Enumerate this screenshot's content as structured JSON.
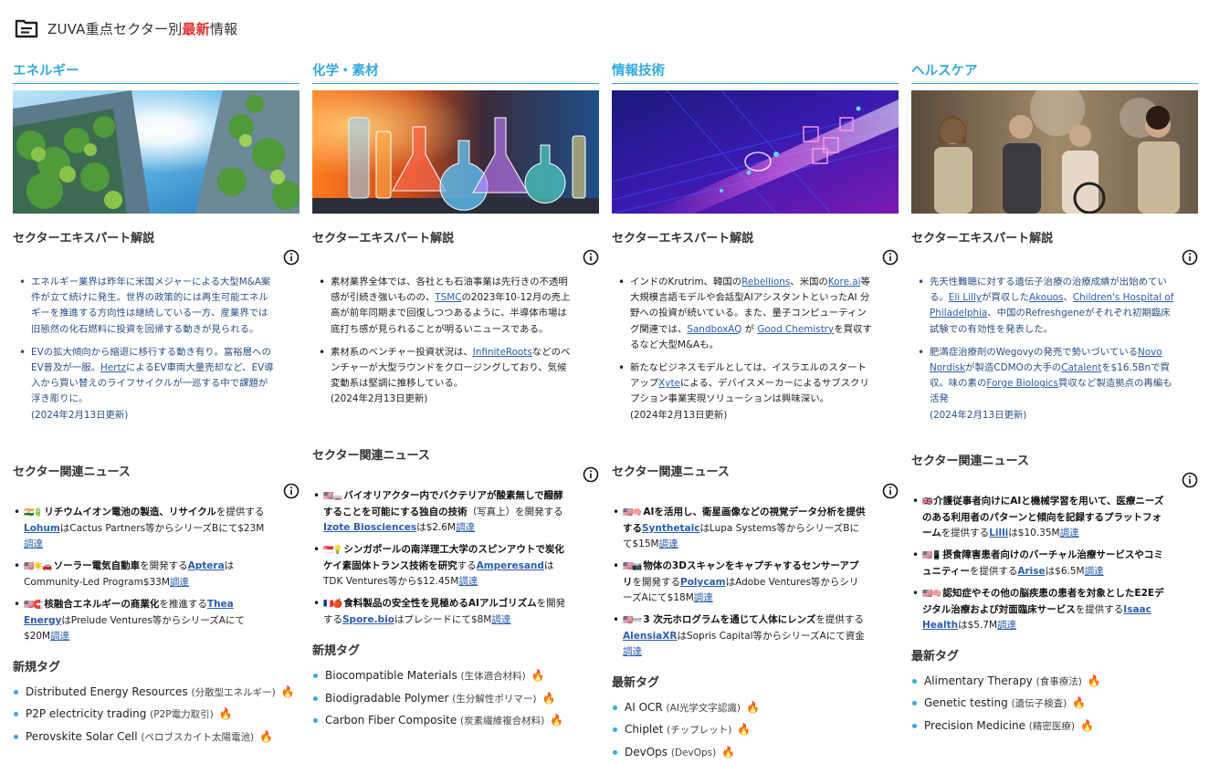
{
  "header": {
    "title_pre": "ZUVA重点セクター別",
    "title_hl": "最新",
    "title_post": "情報"
  },
  "labels": {
    "expert": "セクターエキスパート解説",
    "news": "セクター関連ニュース"
  },
  "columns": [
    {
      "sector": "エネルギー",
      "expert": [
        {
          "segs": [
            {
              "t": "エネルギー業界は昨年に米国メジャーによる大型M&A案件が立て続けに発生。世界の政策的には再生可能エネルギーを推進する方向性は継続している一方、産業界では旧態然の化石燃料に投資を回帰する動きが見られる。"
            }
          ]
        },
        {
          "segs": [
            {
              "t": "EVの拡大傾向から縮退に移行する動き有り。富裕層へのEV普及が一服。"
            },
            {
              "t": "Hertz",
              "link": true
            },
            {
              "t": "によるEV車両大量売却など、EV導入から買い替えのライフサイクルが一巡する中で課題が浮き彫りに。"
            }
          ]
        }
      ],
      "updated": "(2024年2月13日更新)",
      "news": [
        {
          "flags": "🇮🇳🔋",
          "segs": [
            {
              "t": "リチウムイオン電池の製造、リサイクル",
              "b": true
            },
            {
              "t": "を提供する"
            },
            {
              "t": "Lohum",
              "co": true
            },
            {
              "t": "はCactus Partners等からシリーズBにて$23M"
            },
            {
              "t": "調達",
              "link": true
            }
          ]
        },
        {
          "flags": "🇺🇸☀️🚗",
          "segs": [
            {
              "t": "ソーラー電気自動車",
              "b": true
            },
            {
              "t": "を開発する"
            },
            {
              "t": "Aptera",
              "co": true
            },
            {
              "t": "はCommunity-Led Program$33M"
            },
            {
              "t": "調達",
              "link": true
            }
          ]
        },
        {
          "flags": "🇺🇸🧲",
          "segs": [
            {
              "t": "核融合エネルギーの商業化",
              "b": true
            },
            {
              "t": "を推進する"
            },
            {
              "t": "Thea Energy",
              "co": true
            },
            {
              "t": "はPrelude Ventures等からシリーズAにて$20M"
            },
            {
              "t": "調達",
              "link": true
            }
          ]
        }
      ],
      "tag_head": "新規タグ",
      "tags": [
        {
          "en": "Distributed Energy Resources",
          "ja": "(分散型エネルギー)"
        },
        {
          "en": "P2P electricity trading",
          "ja": "(P2P電力取引)"
        },
        {
          "en": "Perovskite Solar Cell",
          "ja": "(ペロブスカイト太陽電池)"
        }
      ]
    },
    {
      "sector": "化学・素材",
      "expert": [
        {
          "segs": [
            {
              "t": "素材業界全体では、各社とも石油事業は先行きの不透明感が引続き強いものの、"
            },
            {
              "t": "TSMC",
              "link": true
            },
            {
              "t": "の2023年10-12月の売上高が前年同期まで回復しつつあるように、半導体市場は底打ち感が見られることが明るいニュースである。"
            }
          ]
        },
        {
          "segs": [
            {
              "t": "素材系のベンチャー投資状況は、"
            },
            {
              "t": "InfiniteRoots",
              "link": true
            },
            {
              "t": "などのベンチャーが大型ラウンドをクロージングしており、気候変動系は堅調に推移している。"
            }
          ]
        }
      ],
      "updated": "(2024年2月13日更新)",
      "news": [
        {
          "flags": "🇺🇸🧫",
          "segs": [
            {
              "t": "バイオリアクター内でバクテリアが酸素無しで醱酵することを可能にする独自の技術",
              "b": true
            },
            {
              "t": "（写真上）を開発する"
            },
            {
              "t": "Izote Biosciences",
              "co": true
            },
            {
              "t": "は$2.6M"
            },
            {
              "t": "調達",
              "link": true
            }
          ]
        },
        {
          "flags": "🇸🇬💡",
          "segs": [
            {
              "t": "シンガポールの南洋理工大学のスピンアウトで炭化ケイ素固体トランス技術を研究",
              "b": true
            },
            {
              "t": "する"
            },
            {
              "t": "Amperesand",
              "co": true
            },
            {
              "t": "はTDK Ventures等から$12.45M"
            },
            {
              "t": "調達",
              "link": true
            }
          ]
        },
        {
          "flags": "🇫🇷🍎",
          "segs": [
            {
              "t": "食料製品の安全性を見極めるAIアルゴリズム",
              "b": true
            },
            {
              "t": "を開発する"
            },
            {
              "t": "Spore.bio",
              "co": true
            },
            {
              "t": "はプレシードにて$8M"
            },
            {
              "t": "調達",
              "link": true
            }
          ]
        }
      ],
      "tag_head": "新規タグ",
      "tags": [
        {
          "en": "Biocompatible Materials",
          "ja": "(生体適合材料)"
        },
        {
          "en": "Biodigradable Polymer",
          "ja": "(生分解性ポリマー)"
        },
        {
          "en": "Carbon Fiber Composite",
          "ja": "(炭素繊維複合材料)"
        }
      ]
    },
    {
      "sector": "情報技術",
      "expert": [
        {
          "segs": [
            {
              "t": "インドのKrutrim、韓国の"
            },
            {
              "t": "Rebellions",
              "link": true
            },
            {
              "t": "、米国の"
            },
            {
              "t": "Kore.ai",
              "link": true
            },
            {
              "t": "等大規模言語モデルや会話型AIアシスタントといったAI 分野への投資が続いている。また、量子コンピューティング関連では、"
            },
            {
              "t": "SandboxAQ",
              "link": true
            },
            {
              "t": " が "
            },
            {
              "t": "Good Chemistry",
              "link": true
            },
            {
              "t": "を買収するなど大型M&Aも。"
            }
          ]
        },
        {
          "segs": [
            {
              "t": "新たなビジネスモデルとしては、イスラエルのスタートアップ"
            },
            {
              "t": "Xyte",
              "link": true
            },
            {
              "t": "による、デバイスメーカーによるサブスクリプション事業実現ソリューションは興味深い。"
            }
          ]
        }
      ],
      "updated": "(2024年2月13日更新)",
      "news": [
        {
          "flags": "🇺🇸🧠",
          "segs": [
            {
              "t": "AIを活用し、衛星画像などの視覚データ分析を提供する",
              "b": true
            },
            {
              "t": "Synthetaic",
              "co": true
            },
            {
              "t": "はLupa Systems等からシリーズBにて$15M"
            },
            {
              "t": "調達",
              "link": true
            }
          ]
        },
        {
          "flags": "🇺🇸📷",
          "segs": [
            {
              "t": "物体の3Dスキャンをキャプチャするセンサーアプリ",
              "b": true
            },
            {
              "t": "を開発する"
            },
            {
              "t": "Polycam",
              "co": true
            },
            {
              "t": "はAdobe Ventures等からシリーズAにて$18M"
            },
            {
              "t": "調達",
              "link": true
            }
          ]
        },
        {
          "flags": "🇺🇸👓",
          "segs": [
            {
              "t": "3 次元ホログラムを通じて人体にレンズ",
              "b": true
            },
            {
              "t": "を提供する"
            },
            {
              "t": "AlensiaXR",
              "co": true
            },
            {
              "t": "はSopris Capital等からシリーズAにて資金"
            },
            {
              "t": "調達",
              "link": true
            }
          ]
        }
      ],
      "tag_head": "最新タグ",
      "tags": [
        {
          "en": "AI OCR",
          "ja": "(AI光学文字認識)"
        },
        {
          "en": "Chiplet",
          "ja": "(チップレット)"
        },
        {
          "en": "DevOps",
          "ja": "(DevOps)"
        }
      ]
    },
    {
      "sector": "ヘルスケア",
      "expert": [
        {
          "segs": [
            {
              "t": "先天性難聴に対する遺伝子治療の治療成績が出始めている。"
            },
            {
              "t": "Eli Lilly",
              "link": true
            },
            {
              "t": "が買収した"
            },
            {
              "t": "Akouos",
              "link": true
            },
            {
              "t": "、"
            },
            {
              "t": "Children's Hospital of Philadelphia",
              "link": true
            },
            {
              "t": "、中国のRefreshgeneがそれぞれ初期臨床試験での有効性を発表した。"
            }
          ]
        },
        {
          "segs": [
            {
              "t": "肥満症治療剤のWegovyの発売で勢いづいている"
            },
            {
              "t": "Novo Nordisk",
              "link": true
            },
            {
              "t": "が製造CDMOの大手の"
            },
            {
              "t": "Catalent",
              "link": true
            },
            {
              "t": "を$16.5Bnで買収。味の素の"
            },
            {
              "t": "Forge Biologics",
              "link": true
            },
            {
              "t": "買収など製造拠点の再編も活発"
            }
          ]
        }
      ],
      "updated": "(2024年2月13日更新)",
      "news": [
        {
          "flags": "🇬🇧",
          "segs": [
            {
              "t": "介護従事者向けにAIと機械学習を用いて、医療ニーズのある利用者のパターンと傾向を記録するプラットフォーム",
              "b": true
            },
            {
              "t": "を提供する"
            },
            {
              "t": "Lilli",
              "co": true
            },
            {
              "t": "は$10.35M"
            },
            {
              "t": "調達",
              "link": true
            }
          ]
        },
        {
          "flags": "🇺🇸📱",
          "segs": [
            {
              "t": "摂食障害患者向けのバーチャル治療サービスやコミュニティー",
              "b": true
            },
            {
              "t": "を提供する"
            },
            {
              "t": "Arise",
              "co": true
            },
            {
              "t": "は$6.5M"
            },
            {
              "t": "調達",
              "link": true
            }
          ]
        },
        {
          "flags": "🇺🇸🧠",
          "segs": [
            {
              "t": "認知症やその他の脳疾患の患者を対象としたE2Eデジタル治療および対面臨床サービス",
              "b": true
            },
            {
              "t": "を提供する"
            },
            {
              "t": "Isaac Health",
              "co": true
            },
            {
              "t": "は$5.7M"
            },
            {
              "t": "調達",
              "link": true
            }
          ]
        }
      ],
      "tag_head": "最新タグ",
      "tags": [
        {
          "en": "Alimentary Therapy",
          "ja": "(食事療法)"
        },
        {
          "en": "Genetic testing",
          "ja": "(遺伝子検査)"
        },
        {
          "en": "Precision Medicine",
          "ja": "(精密医療)"
        }
      ]
    }
  ]
}
